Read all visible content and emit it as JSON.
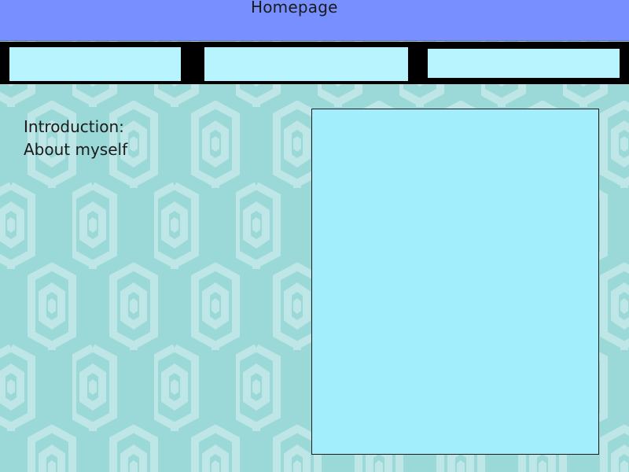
{
  "header": {
    "title": "Homepage"
  },
  "nav": {
    "buttons": [
      {
        "label": ""
      },
      {
        "label": ""
      },
      {
        "label": ""
      }
    ]
  },
  "intro": {
    "line1": "Introduction:",
    "line2": "About myself"
  },
  "colors": {
    "header_bg": "#7890ff",
    "nav_bg": "#000000",
    "nav_button": "#b8f4fd",
    "background": "#9bd8d8",
    "pattern_stroke": "#bfe6e6",
    "panel_bg": "#a3eefc"
  }
}
